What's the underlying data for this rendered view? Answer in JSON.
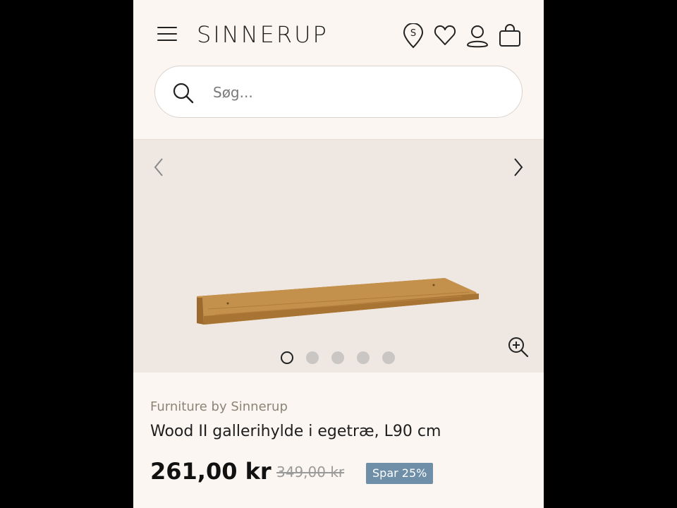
{
  "header": {
    "logo": "SINNERUP",
    "icons": [
      "menu-icon",
      "store-locator-icon",
      "heart-icon",
      "user-icon",
      "bag-icon"
    ]
  },
  "search": {
    "placeholder": "Søg..."
  },
  "gallery": {
    "slides": 5,
    "active_slide": 1
  },
  "product": {
    "brand": "Furniture by Sinnerup",
    "title": "Wood II gallerihylde i egetræ, L90 cm",
    "price": "261,00 kr",
    "old_price": "349,00 kr",
    "discount_badge": "Spar 25%"
  },
  "colors": {
    "background": "#fbf6f2",
    "gallery_bg": "#efe8e2",
    "badge": "#6f8fa8",
    "brand_text": "#8a8577"
  }
}
